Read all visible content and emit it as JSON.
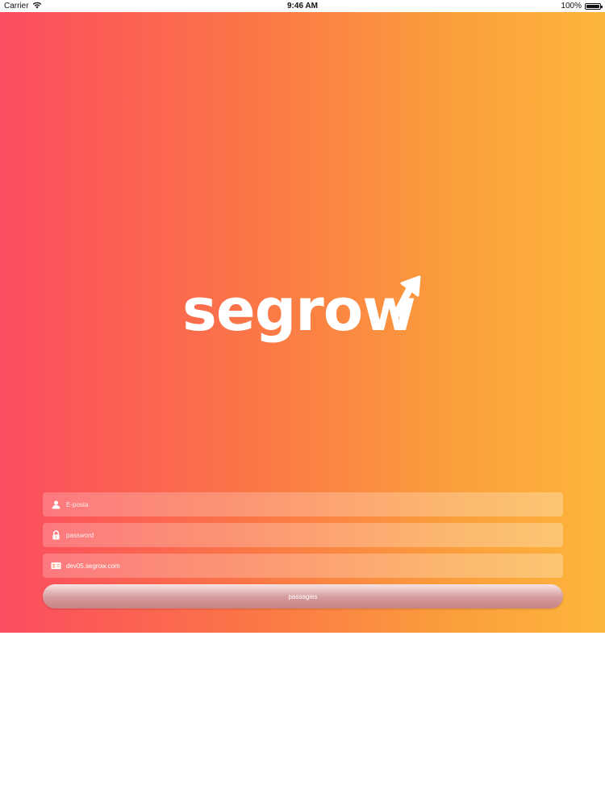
{
  "status_bar": {
    "carrier": "Carrier",
    "time": "9:46 AM",
    "battery": "100%",
    "battery_level": 1.0
  },
  "brand": {
    "logo_text": "segrow",
    "gradient_colors": [
      "#fb4c60",
      "#fb7447",
      "#fb9e3c",
      "#fcb63b"
    ]
  },
  "form": {
    "email": {
      "placeholder": "E-posta",
      "icon": "user-icon"
    },
    "password": {
      "placeholder": "password",
      "icon": "lock-icon"
    },
    "domain": {
      "value": "dev05.segrow.com",
      "icon": "id-card-icon"
    },
    "submit_label": "passagies"
  }
}
